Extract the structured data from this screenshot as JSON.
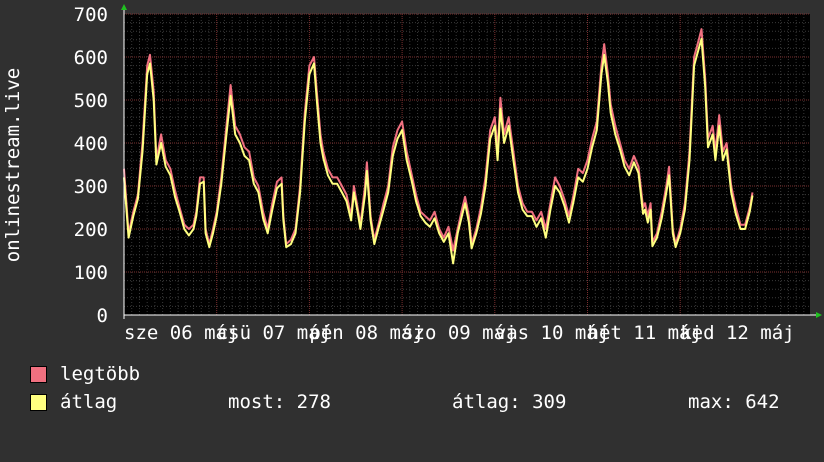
{
  "chart_data": {
    "type": "line",
    "ylabel": "onlinestream.live",
    "ylim": [
      0,
      700
    ],
    "yticks": [
      0,
      100,
      200,
      300,
      400,
      500,
      600,
      700
    ],
    "xlim": [
      0,
      7.4
    ],
    "xticks": [
      {
        "x": 0,
        "label": "sze 06 máj"
      },
      {
        "x": 1,
        "label": "csü 07 máj"
      },
      {
        "x": 2,
        "label": "pén 08 máj"
      },
      {
        "x": 3,
        "label": "szo 09 máj"
      },
      {
        "x": 4,
        "label": "vas 10 máj"
      },
      {
        "x": 5,
        "label": "hét 11 máj"
      },
      {
        "x": 6,
        "label": "ked 12 máj"
      }
    ],
    "grid": true,
    "series": [
      {
        "name": "legtöbb",
        "color": "#f07080",
        "points": [
          [
            0.0,
            340
          ],
          [
            0.05,
            190
          ],
          [
            0.1,
            240
          ],
          [
            0.15,
            280
          ],
          [
            0.2,
            400
          ],
          [
            0.25,
            580
          ],
          [
            0.28,
            605
          ],
          [
            0.32,
            520
          ],
          [
            0.35,
            360
          ],
          [
            0.4,
            420
          ],
          [
            0.45,
            360
          ],
          [
            0.5,
            340
          ],
          [
            0.55,
            290
          ],
          [
            0.6,
            250
          ],
          [
            0.65,
            210
          ],
          [
            0.7,
            200
          ],
          [
            0.75,
            210
          ],
          [
            0.78,
            240
          ],
          [
            0.82,
            320
          ],
          [
            0.86,
            320
          ],
          [
            0.88,
            200
          ],
          [
            0.92,
            165
          ],
          [
            0.96,
            200
          ],
          [
            1.0,
            240
          ],
          [
            1.05,
            320
          ],
          [
            1.1,
            430
          ],
          [
            1.15,
            535
          ],
          [
            1.2,
            440
          ],
          [
            1.25,
            420
          ],
          [
            1.3,
            390
          ],
          [
            1.35,
            380
          ],
          [
            1.4,
            320
          ],
          [
            1.45,
            300
          ],
          [
            1.5,
            240
          ],
          [
            1.55,
            200
          ],
          [
            1.6,
            260
          ],
          [
            1.65,
            310
          ],
          [
            1.7,
            320
          ],
          [
            1.72,
            230
          ],
          [
            1.75,
            165
          ],
          [
            1.8,
            175
          ],
          [
            1.85,
            200
          ],
          [
            1.9,
            300
          ],
          [
            1.95,
            470
          ],
          [
            2.0,
            580
          ],
          [
            2.05,
            600
          ],
          [
            2.08,
            520
          ],
          [
            2.12,
            420
          ],
          [
            2.15,
            380
          ],
          [
            2.2,
            340
          ],
          [
            2.25,
            320
          ],
          [
            2.3,
            320
          ],
          [
            2.35,
            300
          ],
          [
            2.4,
            280
          ],
          [
            2.45,
            230
          ],
          [
            2.48,
            300
          ],
          [
            2.52,
            250
          ],
          [
            2.55,
            210
          ],
          [
            2.6,
            300
          ],
          [
            2.62,
            355
          ],
          [
            2.66,
            230
          ],
          [
            2.7,
            175
          ],
          [
            2.75,
            215
          ],
          [
            2.8,
            260
          ],
          [
            2.85,
            300
          ],
          [
            2.9,
            390
          ],
          [
            2.95,
            430
          ],
          [
            3.0,
            450
          ],
          [
            3.05,
            380
          ],
          [
            3.1,
            330
          ],
          [
            3.15,
            280
          ],
          [
            3.2,
            240
          ],
          [
            3.25,
            230
          ],
          [
            3.3,
            220
          ],
          [
            3.35,
            240
          ],
          [
            3.4,
            200
          ],
          [
            3.45,
            180
          ],
          [
            3.5,
            205
          ],
          [
            3.55,
            150
          ],
          [
            3.6,
            200
          ],
          [
            3.65,
            250
          ],
          [
            3.68,
            275
          ],
          [
            3.72,
            230
          ],
          [
            3.75,
            165
          ],
          [
            3.8,
            200
          ],
          [
            3.85,
            250
          ],
          [
            3.9,
            320
          ],
          [
            3.95,
            430
          ],
          [
            4.0,
            460
          ],
          [
            4.03,
            380
          ],
          [
            4.06,
            505
          ],
          [
            4.1,
            420
          ],
          [
            4.15,
            460
          ],
          [
            4.2,
            380
          ],
          [
            4.25,
            300
          ],
          [
            4.3,
            260
          ],
          [
            4.35,
            240
          ],
          [
            4.4,
            240
          ],
          [
            4.45,
            220
          ],
          [
            4.5,
            240
          ],
          [
            4.55,
            200
          ],
          [
            4.6,
            260
          ],
          [
            4.65,
            320
          ],
          [
            4.7,
            300
          ],
          [
            4.75,
            270
          ],
          [
            4.8,
            230
          ],
          [
            4.85,
            280
          ],
          [
            4.9,
            340
          ],
          [
            4.95,
            330
          ],
          [
            5.0,
            360
          ],
          [
            5.05,
            410
          ],
          [
            5.1,
            450
          ],
          [
            5.15,
            580
          ],
          [
            5.18,
            630
          ],
          [
            5.22,
            560
          ],
          [
            5.25,
            490
          ],
          [
            5.3,
            440
          ],
          [
            5.35,
            400
          ],
          [
            5.4,
            360
          ],
          [
            5.45,
            340
          ],
          [
            5.5,
            370
          ],
          [
            5.55,
            345
          ],
          [
            5.6,
            250
          ],
          [
            5.62,
            260
          ],
          [
            5.65,
            230
          ],
          [
            5.68,
            260
          ],
          [
            5.7,
            170
          ],
          [
            5.75,
            190
          ],
          [
            5.8,
            240
          ],
          [
            5.85,
            300
          ],
          [
            5.88,
            345
          ],
          [
            5.92,
            200
          ],
          [
            5.95,
            165
          ],
          [
            6.0,
            200
          ],
          [
            6.05,
            260
          ],
          [
            6.1,
            380
          ],
          [
            6.15,
            600
          ],
          [
            6.2,
            640
          ],
          [
            6.23,
            665
          ],
          [
            6.27,
            550
          ],
          [
            6.3,
            410
          ],
          [
            6.35,
            440
          ],
          [
            6.38,
            380
          ],
          [
            6.42,
            465
          ],
          [
            6.46,
            380
          ],
          [
            6.5,
            400
          ],
          [
            6.55,
            300
          ],
          [
            6.6,
            250
          ],
          [
            6.65,
            210
          ],
          [
            6.7,
            210
          ],
          [
            6.75,
            250
          ],
          [
            6.78,
            285
          ]
        ]
      },
      {
        "name": "átlag",
        "color": "#ffff80",
        "points": [
          [
            0.0,
            320
          ],
          [
            0.05,
            180
          ],
          [
            0.1,
            230
          ],
          [
            0.15,
            270
          ],
          [
            0.2,
            380
          ],
          [
            0.25,
            560
          ],
          [
            0.28,
            585
          ],
          [
            0.32,
            500
          ],
          [
            0.35,
            350
          ],
          [
            0.4,
            400
          ],
          [
            0.45,
            345
          ],
          [
            0.5,
            325
          ],
          [
            0.55,
            275
          ],
          [
            0.6,
            240
          ],
          [
            0.65,
            200
          ],
          [
            0.7,
            185
          ],
          [
            0.75,
            200
          ],
          [
            0.78,
            230
          ],
          [
            0.82,
            305
          ],
          [
            0.86,
            310
          ],
          [
            0.88,
            190
          ],
          [
            0.92,
            158
          ],
          [
            0.96,
            190
          ],
          [
            1.0,
            230
          ],
          [
            1.05,
            305
          ],
          [
            1.1,
            410
          ],
          [
            1.15,
            510
          ],
          [
            1.2,
            420
          ],
          [
            1.25,
            400
          ],
          [
            1.3,
            370
          ],
          [
            1.35,
            360
          ],
          [
            1.4,
            305
          ],
          [
            1.45,
            285
          ],
          [
            1.5,
            225
          ],
          [
            1.55,
            190
          ],
          [
            1.6,
            245
          ],
          [
            1.65,
            295
          ],
          [
            1.7,
            305
          ],
          [
            1.72,
            220
          ],
          [
            1.75,
            158
          ],
          [
            1.8,
            165
          ],
          [
            1.85,
            190
          ],
          [
            1.9,
            285
          ],
          [
            1.95,
            450
          ],
          [
            2.0,
            560
          ],
          [
            2.05,
            585
          ],
          [
            2.08,
            500
          ],
          [
            2.12,
            400
          ],
          [
            2.15,
            365
          ],
          [
            2.2,
            325
          ],
          [
            2.25,
            305
          ],
          [
            2.3,
            305
          ],
          [
            2.35,
            285
          ],
          [
            2.4,
            265
          ],
          [
            2.45,
            220
          ],
          [
            2.48,
            285
          ],
          [
            2.52,
            240
          ],
          [
            2.55,
            200
          ],
          [
            2.6,
            280
          ],
          [
            2.62,
            335
          ],
          [
            2.66,
            220
          ],
          [
            2.7,
            165
          ],
          [
            2.75,
            205
          ],
          [
            2.8,
            245
          ],
          [
            2.85,
            285
          ],
          [
            2.9,
            370
          ],
          [
            2.95,
            410
          ],
          [
            3.0,
            430
          ],
          [
            3.05,
            360
          ],
          [
            3.1,
            315
          ],
          [
            3.15,
            265
          ],
          [
            3.2,
            230
          ],
          [
            3.25,
            215
          ],
          [
            3.3,
            205
          ],
          [
            3.35,
            225
          ],
          [
            3.4,
            190
          ],
          [
            3.45,
            170
          ],
          [
            3.5,
            190
          ],
          [
            3.55,
            120
          ],
          [
            3.6,
            190
          ],
          [
            3.65,
            235
          ],
          [
            3.68,
            260
          ],
          [
            3.72,
            215
          ],
          [
            3.75,
            155
          ],
          [
            3.8,
            190
          ],
          [
            3.85,
            235
          ],
          [
            3.9,
            300
          ],
          [
            3.95,
            410
          ],
          [
            4.0,
            440
          ],
          [
            4.03,
            360
          ],
          [
            4.06,
            480
          ],
          [
            4.1,
            400
          ],
          [
            4.15,
            440
          ],
          [
            4.2,
            360
          ],
          [
            4.25,
            285
          ],
          [
            4.3,
            245
          ],
          [
            4.35,
            230
          ],
          [
            4.4,
            230
          ],
          [
            4.45,
            205
          ],
          [
            4.5,
            225
          ],
          [
            4.55,
            180
          ],
          [
            4.6,
            245
          ],
          [
            4.65,
            300
          ],
          [
            4.7,
            285
          ],
          [
            4.75,
            255
          ],
          [
            4.8,
            215
          ],
          [
            4.85,
            265
          ],
          [
            4.9,
            320
          ],
          [
            4.95,
            310
          ],
          [
            5.0,
            340
          ],
          [
            5.05,
            390
          ],
          [
            5.1,
            430
          ],
          [
            5.15,
            560
          ],
          [
            5.18,
            605
          ],
          [
            5.22,
            540
          ],
          [
            5.25,
            470
          ],
          [
            5.3,
            420
          ],
          [
            5.35,
            385
          ],
          [
            5.4,
            345
          ],
          [
            5.45,
            325
          ],
          [
            5.5,
            355
          ],
          [
            5.55,
            330
          ],
          [
            5.6,
            235
          ],
          [
            5.62,
            245
          ],
          [
            5.65,
            215
          ],
          [
            5.68,
            245
          ],
          [
            5.7,
            160
          ],
          [
            5.75,
            180
          ],
          [
            5.8,
            225
          ],
          [
            5.85,
            285
          ],
          [
            5.88,
            325
          ],
          [
            5.92,
            190
          ],
          [
            5.95,
            158
          ],
          [
            6.0,
            190
          ],
          [
            6.05,
            245
          ],
          [
            6.1,
            360
          ],
          [
            6.15,
            580
          ],
          [
            6.2,
            620
          ],
          [
            6.23,
            642
          ],
          [
            6.27,
            530
          ],
          [
            6.3,
            390
          ],
          [
            6.35,
            420
          ],
          [
            6.38,
            360
          ],
          [
            6.42,
            440
          ],
          [
            6.46,
            360
          ],
          [
            6.5,
            385
          ],
          [
            6.55,
            285
          ],
          [
            6.6,
            235
          ],
          [
            6.65,
            200
          ],
          [
            6.7,
            200
          ],
          [
            6.75,
            240
          ],
          [
            6.78,
            278
          ]
        ]
      }
    ]
  },
  "legend": [
    {
      "label": "legtöbb",
      "color": "#f07080"
    },
    {
      "label": "átlag",
      "color": "#ffff80"
    }
  ],
  "stats": {
    "current": "most: 278",
    "average": "átlag: 309",
    "maximum": "max: 642"
  }
}
